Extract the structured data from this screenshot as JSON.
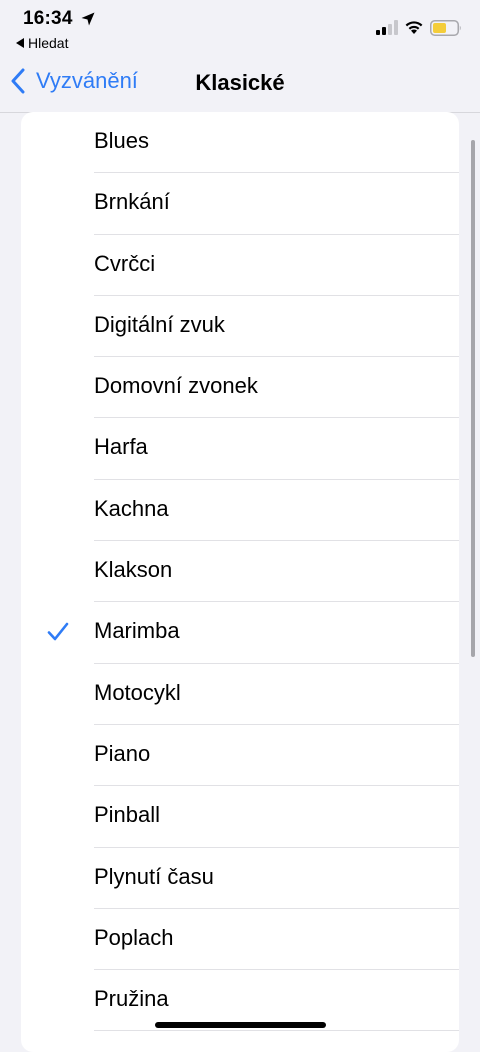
{
  "status_bar": {
    "time": "16:34",
    "back_app_label": "Hledat"
  },
  "nav": {
    "back_label": "Vyzvánění",
    "title": "Klasické"
  },
  "list": {
    "items": [
      {
        "label": "Blues",
        "selected": false
      },
      {
        "label": "Brnkání",
        "selected": false
      },
      {
        "label": "Cvrčci",
        "selected": false
      },
      {
        "label": "Digitální zvuk",
        "selected": false
      },
      {
        "label": "Domovní zvonek",
        "selected": false
      },
      {
        "label": "Harfa",
        "selected": false
      },
      {
        "label": "Kachna",
        "selected": false
      },
      {
        "label": "Klakson",
        "selected": false
      },
      {
        "label": "Marimba",
        "selected": true
      },
      {
        "label": "Motocykl",
        "selected": false
      },
      {
        "label": "Piano",
        "selected": false
      },
      {
        "label": "Pinball",
        "selected": false
      },
      {
        "label": "Plynutí času",
        "selected": false
      },
      {
        "label": "Poplach",
        "selected": false
      },
      {
        "label": "Pružina",
        "selected": false
      }
    ]
  },
  "colors": {
    "accent": "#2f7cf6",
    "background": "#f2f2f7",
    "battery_fill": "#f4cd3a"
  },
  "icons": {
    "location": "location-arrow-icon",
    "back_app": "back-triangle-icon",
    "signal": "cellular-signal-icon",
    "wifi": "wifi-icon",
    "battery": "battery-icon",
    "back": "chevron-left-icon",
    "check": "checkmark-icon"
  }
}
